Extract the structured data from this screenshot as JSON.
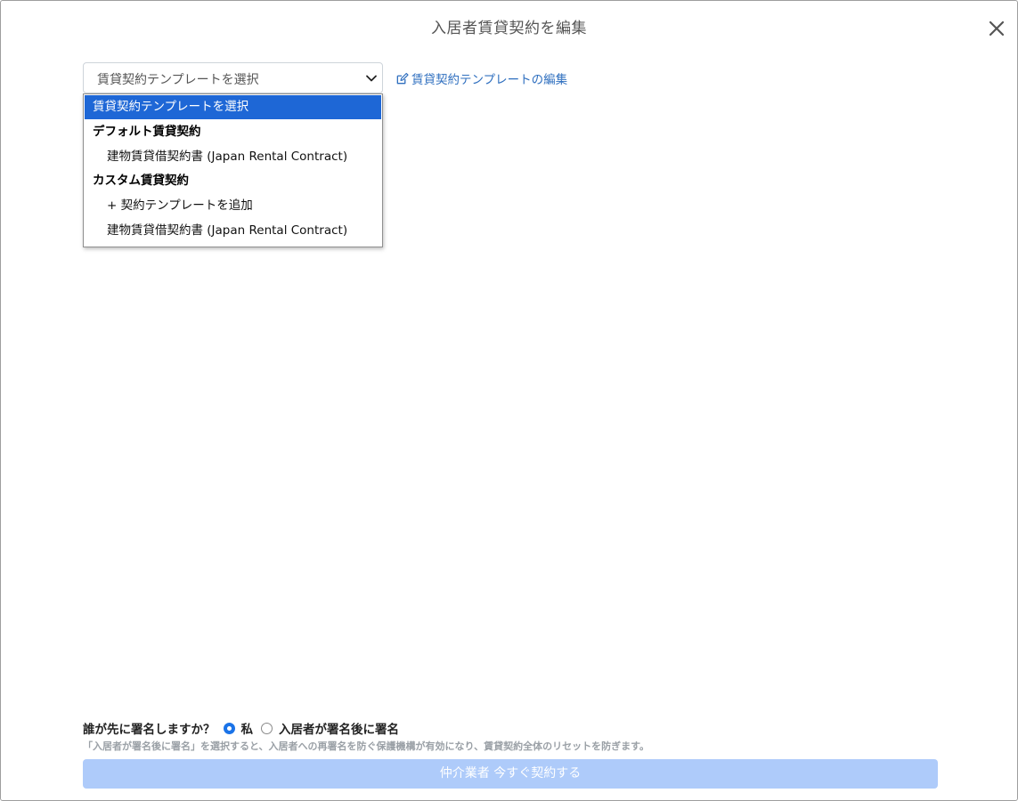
{
  "modal": {
    "title": "入居者賃貸契約を編集"
  },
  "template_select": {
    "placeholder": "賃貸契約テンプレートを選択",
    "edit_link": "賃貸契約テンプレートの編集"
  },
  "dropdown": {
    "items": [
      {
        "label": "賃貸契約テンプレートを選択",
        "kind": "option",
        "selected": true
      },
      {
        "label": "デフォルト賃貸契約",
        "kind": "group"
      },
      {
        "label": "建物賃貸借契約書 (Japan Rental Contract)",
        "kind": "option"
      },
      {
        "label": "カスタム賃貸契約",
        "kind": "group"
      },
      {
        "label": "+ 契約テンプレートを追加",
        "kind": "option"
      },
      {
        "label": "建物賃貸借契約書 (Japan Rental Contract)",
        "kind": "option"
      }
    ]
  },
  "signing": {
    "question": "誰が先に署名しますか？",
    "option_me": "私",
    "option_tenant": "入居者が署名後に署名",
    "selected": "私",
    "hint": "「入居者が署名後に署名」を選択すると、入居者への再署名を防ぐ保護機構が有効になり、賃貸契約全体のリセットを防ぎます。"
  },
  "submit": {
    "label": "仲介業者 今すぐ契約する"
  },
  "colors": {
    "accent": "#1e67d6",
    "link": "#2f6fbf",
    "button_disabled": "#aecbfa",
    "hint": "#9aa0a6"
  },
  "icons": {
    "close": "close-icon",
    "edit": "edit-icon",
    "chevron": "chevron-down-icon"
  }
}
